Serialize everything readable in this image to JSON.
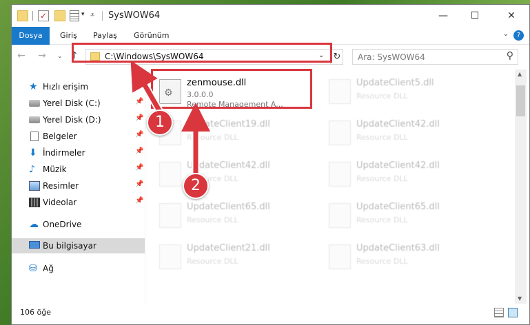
{
  "window": {
    "title": "SysWOW64"
  },
  "ribbon": {
    "tabs": [
      "Dosya",
      "Giriş",
      "Paylaş",
      "Görünüm"
    ],
    "help": "?"
  },
  "address": {
    "path": "C:\\Windows\\SysWOW64"
  },
  "search": {
    "placeholder": "Ara: SysWOW64"
  },
  "sidebar": {
    "items": [
      {
        "label": "Hızlı erişim",
        "icon": "star-icon"
      },
      {
        "label": "Yerel Disk (C:)",
        "icon": "drive-icon"
      },
      {
        "label": "Yerel Disk (D:)",
        "icon": "drive-icon"
      },
      {
        "label": "Belgeler",
        "icon": "document-icon"
      },
      {
        "label": "İndirmeler",
        "icon": "download-icon"
      },
      {
        "label": "Müzik",
        "icon": "music-icon"
      },
      {
        "label": "Resimler",
        "icon": "picture-icon"
      },
      {
        "label": "Videolar",
        "icon": "video-icon"
      },
      {
        "label": "OneDrive",
        "icon": "cloud-icon"
      },
      {
        "label": "Bu bilgisayar",
        "icon": "computer-icon"
      },
      {
        "label": "Ağ",
        "icon": "network-icon"
      }
    ]
  },
  "files": {
    "highlighted": {
      "name": "zenmouse.dll",
      "version": "3.0.0.0",
      "description": "Remote Management A..."
    },
    "items": [
      {
        "name": "UpdateClient5.dll",
        "type": "Resource DLL"
      },
      {
        "name": "UpdateClient19.dll",
        "type": "Resource DLL"
      },
      {
        "name": "UpdateClient42.dll",
        "type": "Resource DLL"
      },
      {
        "name": "UpdateClient42.dll",
        "type": "Resource DLL"
      },
      {
        "name": "UpdateClient42.dll",
        "type": "Resource DLL"
      },
      {
        "name": "UpdateClient65.dll",
        "type": "Resource DLL"
      },
      {
        "name": "UpdateClient65.dll",
        "type": "Resource DLL"
      },
      {
        "name": "UpdateClient21.dll",
        "type": "Resource DLL"
      },
      {
        "name": "UpdateClient63.dll",
        "type": "Resource DLL"
      }
    ]
  },
  "status": {
    "count": "106 öğe"
  },
  "annotations": {
    "step1": "1",
    "step2": "2",
    "color": "#d9363e"
  }
}
